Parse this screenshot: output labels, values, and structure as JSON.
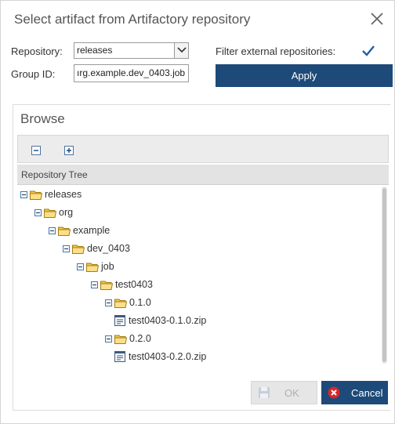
{
  "dialog": {
    "title": "Select artifact from Artifactory repository"
  },
  "form": {
    "repository_label": "Repository:",
    "repository_value": "releases",
    "filter_label": "Filter external repositories:",
    "filter_checked": true,
    "group_label": "Group ID:",
    "group_value": "org.example.dev_0403.job",
    "group_visible_text": "ırg.example.dev_0403.job",
    "apply_label": "Apply"
  },
  "browse": {
    "title": "Browse",
    "tree_header": "Repository Tree",
    "nodes": [
      {
        "label": "releases",
        "type": "folder",
        "depth": 0
      },
      {
        "label": "org",
        "type": "folder",
        "depth": 1
      },
      {
        "label": "example",
        "type": "folder",
        "depth": 2
      },
      {
        "label": "dev_0403",
        "type": "folder",
        "depth": 3
      },
      {
        "label": "job",
        "type": "folder",
        "depth": 4
      },
      {
        "label": "test0403",
        "type": "folder",
        "depth": 5
      },
      {
        "label": "0.1.0",
        "type": "folder",
        "depth": 6
      },
      {
        "label": "test0403-0.1.0.zip",
        "type": "file",
        "depth": 7
      },
      {
        "label": "0.2.0",
        "type": "folder",
        "depth": 6
      },
      {
        "label": "test0403-0.2.0.zip",
        "type": "file",
        "depth": 7
      }
    ]
  },
  "buttons": {
    "ok_label": "OK",
    "cancel_label": "Cancel"
  },
  "icons": {
    "close": "close-icon",
    "collapse_all": "collapse-all-icon",
    "expand_all": "expand-all-icon",
    "checkbox": "checkmark-icon",
    "folder": "folder-open-icon",
    "file": "file-icon",
    "save": "save-icon",
    "cancel": "cancel-icon"
  },
  "colors": {
    "accent": "#1d4a79",
    "folder": "#f3c84b",
    "cancel_icon": "#d9262c"
  }
}
